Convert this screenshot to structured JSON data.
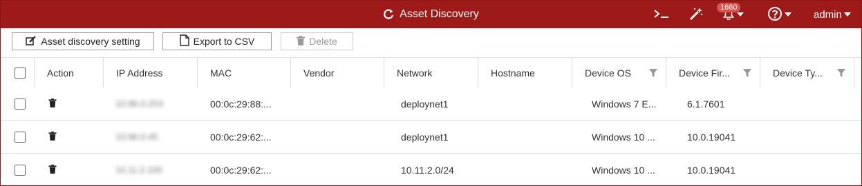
{
  "header": {
    "title": "Asset Discovery",
    "notification_count": "1660",
    "user_label": "admin"
  },
  "toolbar": {
    "asset_discovery_setting_label": "Asset discovery setting",
    "export_csv_label": "Export to CSV",
    "delete_label": "Delete"
  },
  "table": {
    "columns": [
      "Action",
      "IP Address",
      "MAC",
      "Vendor",
      "Network",
      "Hostname",
      "Device OS",
      "Device Fir...",
      "Device Ty..."
    ],
    "rows": [
      {
        "ip": "10.96.0.253",
        "mac": "00:0c:29:88:...",
        "vendor": "",
        "network": "deploynet1",
        "hostname": "",
        "os": "Windows 7 E...",
        "firmware": "6.1.7601",
        "type": ""
      },
      {
        "ip": "10.96.0.45",
        "mac": "00:0c:29:62:...",
        "vendor": "",
        "network": "deploynet1",
        "hostname": "",
        "os": "Windows 10 ...",
        "firmware": "10.0.19041",
        "type": ""
      },
      {
        "ip": "10.11.2.100",
        "mac": "00:0c:29:62:...",
        "vendor": "",
        "network": "10.11.2.0/24",
        "hostname": "",
        "os": "Windows 10 ...",
        "firmware": "10.0.19041",
        "type": ""
      }
    ]
  },
  "colors": {
    "header_bg": "#9e1a18",
    "badge": "#d9534f"
  }
}
